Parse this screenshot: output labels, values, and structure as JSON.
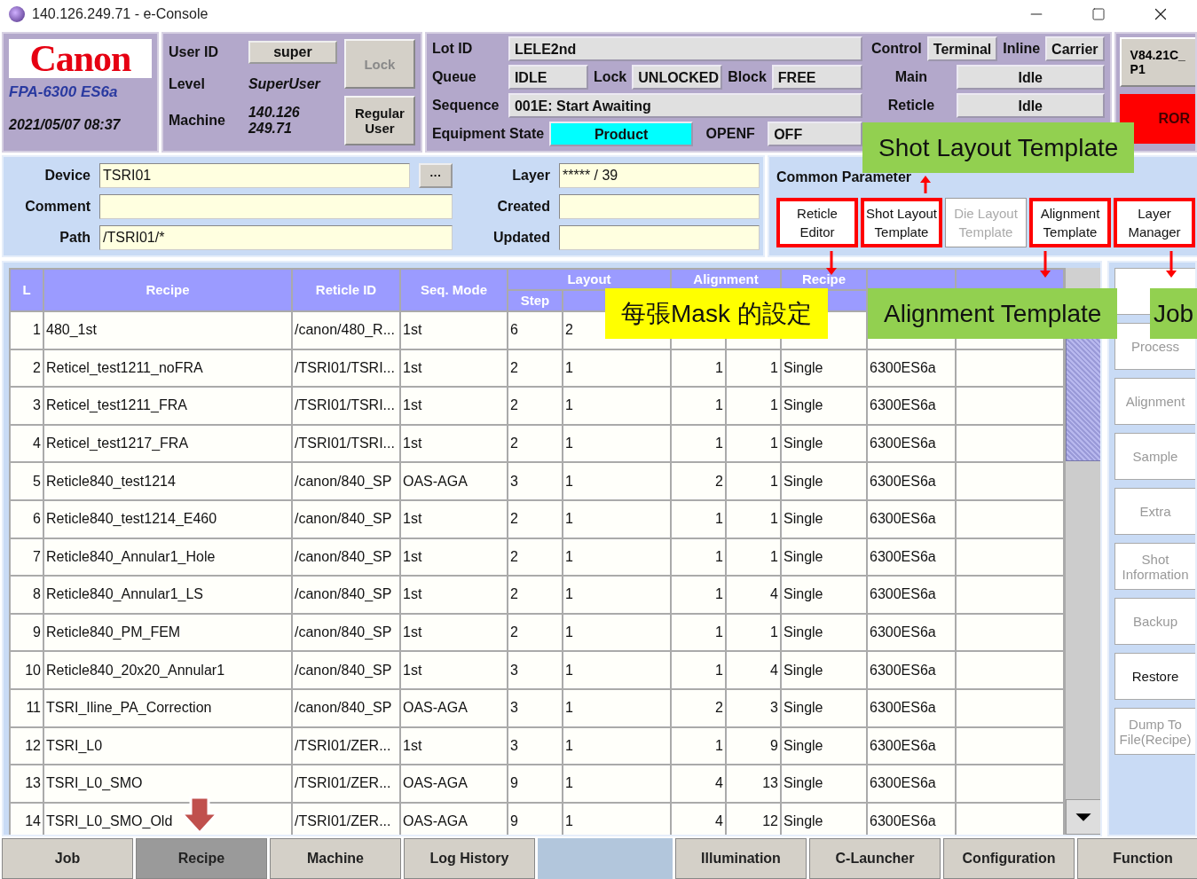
{
  "window": {
    "title": "140.126.249.71 - e-Console"
  },
  "header": {
    "logo": "Canon",
    "model": "FPA-6300 ES6a",
    "datetime": "2021/05/07 08:37",
    "user": [
      {
        "label": "User ID",
        "value": "super",
        "kind": "box"
      },
      {
        "label": "Level",
        "value": "SuperUser",
        "kind": "italic"
      },
      {
        "label": "Machine",
        "value": "140.126 249.71",
        "kind": "italic"
      }
    ],
    "user_buttons": [
      {
        "label": "Lock",
        "disabled": true
      },
      {
        "label": "Regular User",
        "disabled": false
      }
    ],
    "lot_id": {
      "label": "Lot ID",
      "value": "LELE2nd"
    },
    "queue": [
      {
        "label": "Queue",
        "value": "IDLE"
      },
      {
        "label": "Lock",
        "value": "UNLOCKED"
      },
      {
        "label": "Block",
        "value": "FREE"
      }
    ],
    "sequence": {
      "label": "Sequence",
      "value": "001E: Start Awaiting"
    },
    "equipment_state": {
      "label": "Equipment State",
      "value": "Product",
      "color": "#00ffff"
    },
    "openf": {
      "label": "OPENF",
      "value": "OFF"
    },
    "control": {
      "label": "Control",
      "modes": [
        {
          "label": "Terminal",
          "boxed": true
        },
        {
          "label": "Inline",
          "boxed": false
        },
        {
          "label": "Carrier",
          "boxed": true
        }
      ]
    },
    "status": [
      {
        "label": "Main",
        "value": "Idle"
      },
      {
        "label": "Reticle",
        "value": "Idle"
      }
    ],
    "version_button": "V84.21C_ P1",
    "error_button": "ROR"
  },
  "device": {
    "fields": [
      {
        "label": "Device",
        "value": "TSRI01",
        "browse": "···"
      },
      {
        "label": "Comment"
      },
      {
        "label": "Path",
        "value": "/TSRI01/*"
      }
    ],
    "info": [
      {
        "label": "Layer",
        "value": "***** / 39"
      },
      {
        "label": "Created"
      },
      {
        "label": "Updated"
      }
    ]
  },
  "common_parameter": {
    "title": "Common Parameter",
    "buttons": [
      {
        "label": "Reticle Editor",
        "disabled": false,
        "highlighted": true
      },
      {
        "label": "Shot Layout Template",
        "disabled": false,
        "highlighted": true
      },
      {
        "label": "Die Layout Template",
        "disabled": true,
        "highlighted": false
      },
      {
        "label": "Alignment Template",
        "disabled": false,
        "highlighted": true
      },
      {
        "label": "Layer Manager",
        "disabled": false,
        "highlighted": true
      }
    ]
  },
  "table": {
    "columns": [
      "L",
      "Recipe",
      "Reticle ID",
      "Seq. Mode"
    ],
    "groups": [
      "Layout",
      "Alignment",
      "Recipe"
    ],
    "subcolumns": [
      "Step"
    ],
    "rows": [
      {
        "l": "1",
        "recipe": "480_1st",
        "reticle_id": "/canon/480_R...",
        "seq_mode": "1st",
        "step": "6",
        "layout_2": "2"
      },
      {
        "l": "2",
        "recipe": "Reticel_test1211_noFRA",
        "reticle_id": "/TSRI01/TSRI...",
        "seq_mode": "1st",
        "step": "2",
        "layout_2": "1",
        "alignment_1": "1",
        "alignment_2": "1",
        "recipe_type": "Single",
        "machine": "6300ES6a"
      },
      {
        "l": "3",
        "recipe": "Reticel_test1211_FRA",
        "reticle_id": "/TSRI01/TSRI...",
        "seq_mode": "1st",
        "step": "2",
        "layout_2": "1",
        "alignment_1": "1",
        "alignment_2": "1",
        "recipe_type": "Single",
        "machine": "6300ES6a"
      },
      {
        "l": "4",
        "recipe": "Reticel_test1217_FRA",
        "reticle_id": "/TSRI01/TSRI...",
        "seq_mode": "1st",
        "step": "2",
        "layout_2": "1",
        "alignment_1": "1",
        "alignment_2": "1",
        "recipe_type": "Single",
        "machine": "6300ES6a"
      },
      {
        "l": "5",
        "recipe": "Reticle840_test1214",
        "reticle_id": "/canon/840_SP",
        "seq_mode": "OAS-AGA",
        "step": "3",
        "layout_2": "1",
        "alignment_1": "2",
        "alignment_2": "1",
        "recipe_type": "Single",
        "machine": "6300ES6a"
      },
      {
        "l": "6",
        "recipe": "Reticle840_test1214_E460",
        "reticle_id": "/canon/840_SP",
        "seq_mode": "1st",
        "step": "2",
        "layout_2": "1",
        "alignment_1": "1",
        "alignment_2": "1",
        "recipe_type": "Single",
        "machine": "6300ES6a"
      },
      {
        "l": "7",
        "recipe": "Reticle840_Annular1_Hole",
        "reticle_id": "/canon/840_SP",
        "seq_mode": "1st",
        "step": "2",
        "layout_2": "1",
        "alignment_1": "1",
        "alignment_2": "1",
        "recipe_type": "Single",
        "machine": "6300ES6a"
      },
      {
        "l": "8",
        "recipe": "Reticle840_Annular1_LS",
        "reticle_id": "/canon/840_SP",
        "seq_mode": "1st",
        "step": "2",
        "layout_2": "1",
        "alignment_1": "1",
        "alignment_2": "4",
        "recipe_type": "Single",
        "machine": "6300ES6a"
      },
      {
        "l": "9",
        "recipe": "Reticle840_PM_FEM",
        "reticle_id": "/canon/840_SP",
        "seq_mode": "1st",
        "step": "2",
        "layout_2": "1",
        "alignment_1": "1",
        "alignment_2": "1",
        "recipe_type": "Single",
        "machine": "6300ES6a"
      },
      {
        "l": "10",
        "recipe": "Reticle840_20x20_Annular1",
        "reticle_id": "/canon/840_SP",
        "seq_mode": "1st",
        "step": "3",
        "layout_2": "1",
        "alignment_1": "1",
        "alignment_2": "4",
        "recipe_type": "Single",
        "machine": "6300ES6a"
      },
      {
        "l": "11",
        "recipe": "TSRI_Iline_PA_Correction",
        "reticle_id": "/canon/840_SP",
        "seq_mode": "OAS-AGA",
        "step": "3",
        "layout_2": "1",
        "alignment_1": "2",
        "alignment_2": "3",
        "recipe_type": "Single",
        "machine": "6300ES6a"
      },
      {
        "l": "12",
        "recipe": "TSRI_L0",
        "reticle_id": "/TSRI01/ZER...",
        "seq_mode": "1st",
        "step": "3",
        "layout_2": "1",
        "alignment_1": "1",
        "alignment_2": "9",
        "recipe_type": "Single",
        "machine": "6300ES6a"
      },
      {
        "l": "13",
        "recipe": "TSRI_L0_SMO",
        "reticle_id": "/TSRI01/ZER...",
        "seq_mode": "OAS-AGA",
        "step": "9",
        "layout_2": "1",
        "alignment_1": "4",
        "alignment_2": "13",
        "recipe_type": "Single",
        "machine": "6300ES6a"
      },
      {
        "l": "14",
        "recipe": "TSRI_L0_SMO_Old",
        "reticle_id": "/TSRI01/ZER...",
        "seq_mode": "OAS-AGA",
        "step": "9",
        "layout_2": "1",
        "alignment_1": "4",
        "alignment_2": "12",
        "recipe_type": "Single",
        "machine": "6300ES6a"
      }
    ]
  },
  "side_buttons": [
    {
      "label": "Process",
      "disabled": true
    },
    {
      "label": "Alignment",
      "disabled": true
    },
    {
      "label": "Sample",
      "disabled": true
    },
    {
      "label": "Extra",
      "disabled": true
    },
    {
      "label": "Shot Information",
      "disabled": true
    },
    {
      "label": "Backup",
      "disabled": true
    },
    {
      "label": "Restore",
      "disabled": false
    },
    {
      "label": "Dump To File(Recipe)",
      "disabled": true
    }
  ],
  "bottom_tabs": [
    {
      "label": "Job",
      "selected": false
    },
    {
      "label": "Recipe",
      "selected": true
    },
    {
      "label": "Machine",
      "selected": false
    },
    {
      "label": "Log History",
      "selected": false
    },
    {
      "label": "Illumination",
      "selected": false
    },
    {
      "label": "C-Launcher",
      "selected": false
    },
    {
      "label": "Configuration",
      "selected": false
    },
    {
      "label": "Function",
      "selected": false
    }
  ],
  "annotations": [
    {
      "text": "Shot Layout Template",
      "color": "#92d050"
    },
    {
      "text": "每張Mask 的設定",
      "color": "#ffff00"
    },
    {
      "text": "Alignment Template",
      "color": "#92d050"
    },
    {
      "text": "Job",
      "color": "#92d050"
    }
  ]
}
